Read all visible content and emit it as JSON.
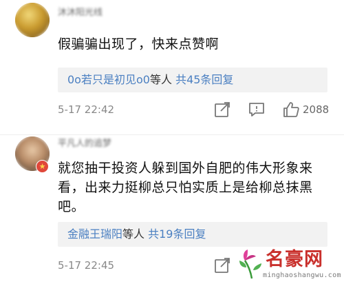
{
  "comments": [
    {
      "username": "沐沐阳光线",
      "text": "假骗骗出现了，快来点赞啊",
      "reply": {
        "nick": "0o若只是初见o0",
        "tail": "等人",
        "count": "共45条回复"
      },
      "time": "5-17 22:42",
      "likes": "2088"
    },
    {
      "username": "平凡人的追梦",
      "text": "就您抽干投资人躲到国外自肥的伟大形象来看，出来力挺柳总只怕实质上是给柳总抹黑吧。",
      "reply": {
        "nick": "金融王瑞阳",
        "tail": "等人",
        "count": "共19条回复"
      },
      "time": "5-17 22:45",
      "likes": ""
    }
  ],
  "watermark": {
    "title": "名豪网",
    "url": "minghaoshangwu.com"
  },
  "icons": {
    "share": "share-icon",
    "comment": "comment-icon",
    "like": "thumbs-up-icon",
    "badge": "vip-badge-icon"
  },
  "colors": {
    "link": "#4a7fc1",
    "watermark": "#c9302c"
  }
}
